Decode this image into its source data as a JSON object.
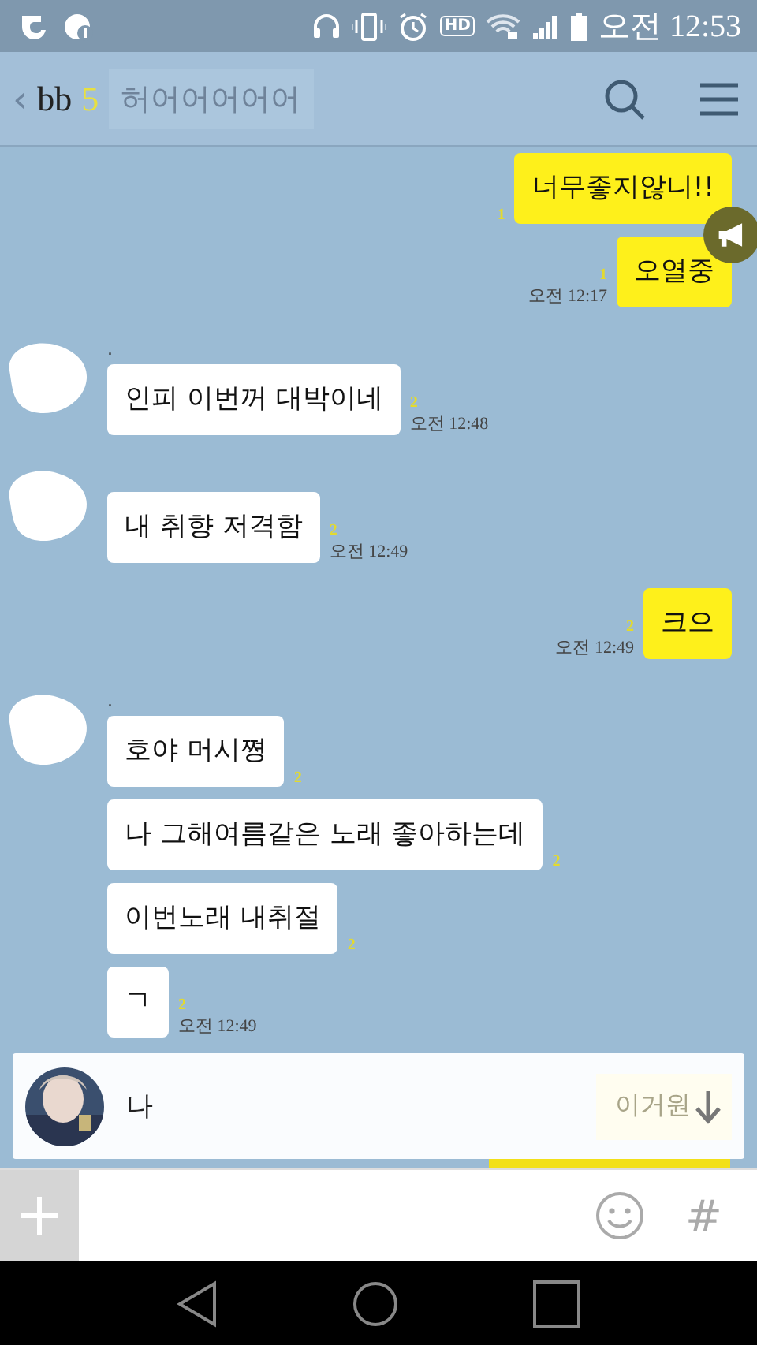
{
  "status_bar": {
    "hd_label": "HD",
    "time": "오전 12:53"
  },
  "header": {
    "back": "‹",
    "title": "bb",
    "member_count": "5",
    "ghost_message": "허어어어어어"
  },
  "messages": [
    {
      "kind": "sent",
      "text": "너무좋지않니!!",
      "unread": "1"
    },
    {
      "kind": "sent",
      "text": "오열중",
      "unread": "1",
      "time": "오전 12:17"
    },
    {
      "kind": "received",
      "avatar": true,
      "sender": ".",
      "text": "인피 이번꺼 대박이네",
      "unread": "2",
      "time": "오전 12:48"
    },
    {
      "kind": "received",
      "avatar": true,
      "text": "내 취향 저격함",
      "unread": "2",
      "time": "오전 12:49"
    },
    {
      "kind": "sent",
      "text": "크으",
      "unread": "2",
      "time": "오전 12:49"
    },
    {
      "kind": "received",
      "avatar": true,
      "sender": ".",
      "text": "호야 머시쪙",
      "unread": "2"
    },
    {
      "kind": "received",
      "avatar": false,
      "text": "나 그해여름같은 노래 좋아하는데",
      "unread": "2"
    },
    {
      "kind": "received",
      "avatar": false,
      "text": "이번노래 내취절",
      "unread": "2"
    },
    {
      "kind": "received",
      "avatar": false,
      "text": "ㄱ",
      "unread": "2",
      "time": "오전 12:49"
    }
  ],
  "preview": {
    "text": "나",
    "faded_text": "이거원"
  },
  "input": {
    "hash": "#"
  }
}
